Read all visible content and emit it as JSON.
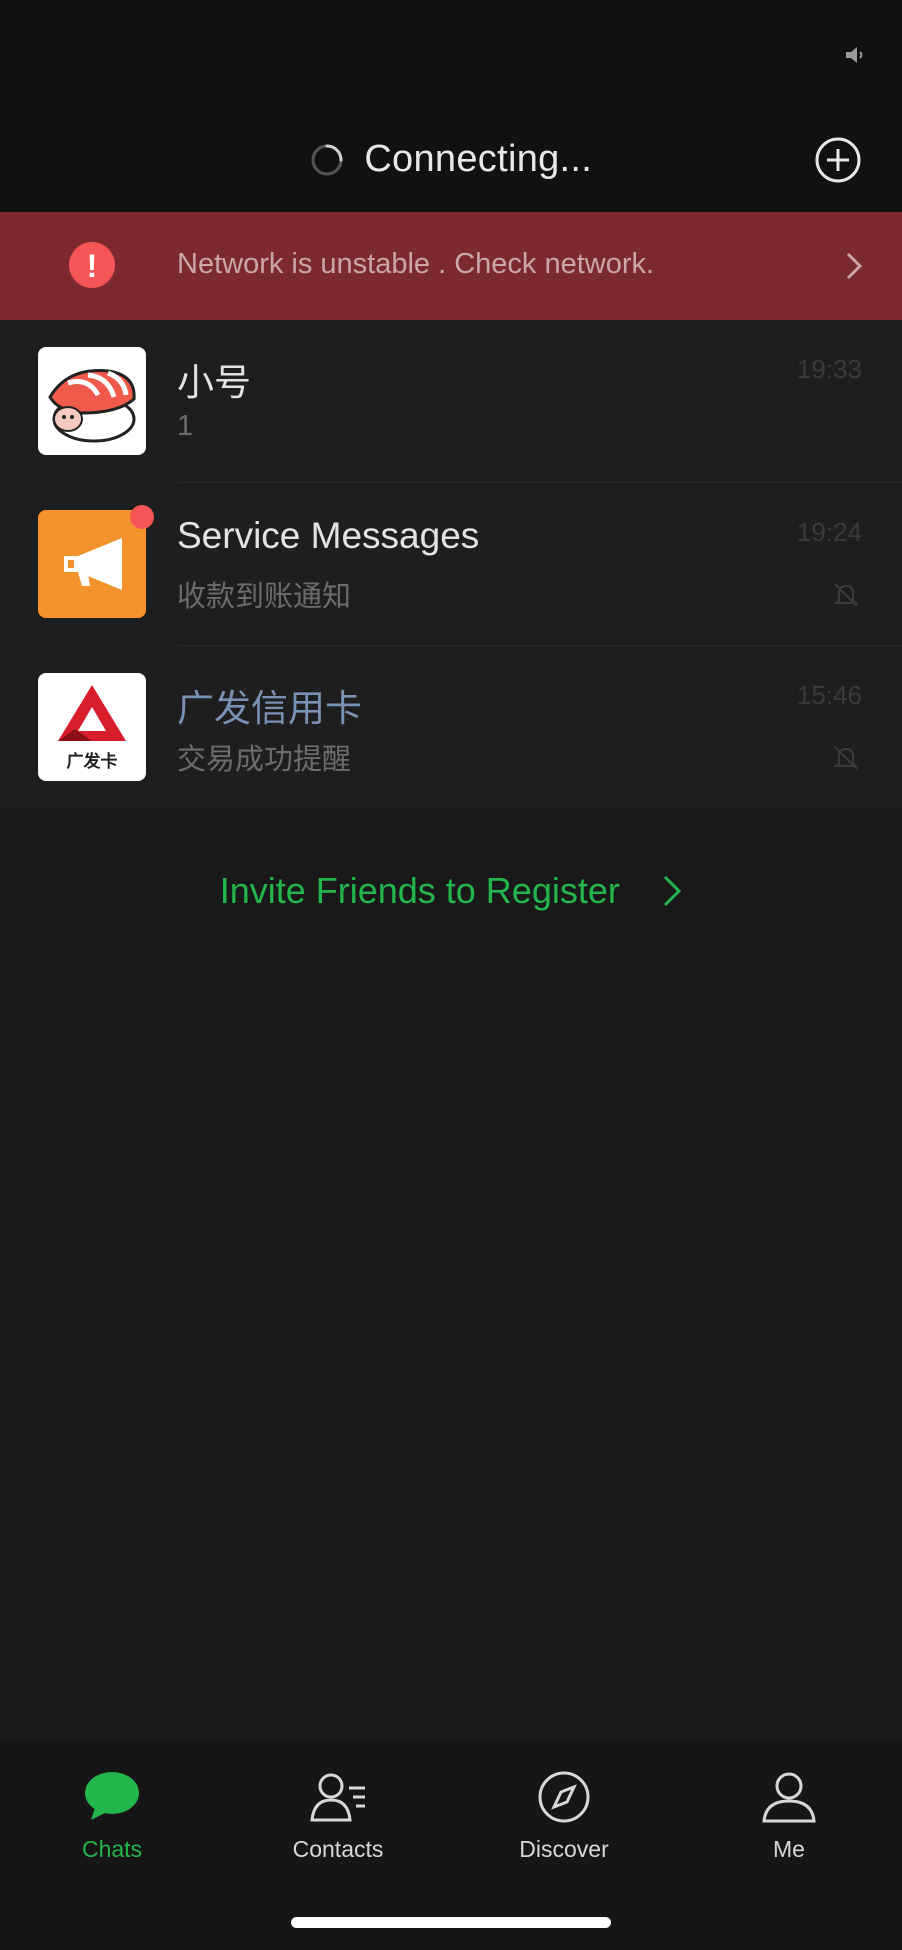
{
  "nav": {
    "title": "Connecting..."
  },
  "banner": {
    "text": "Network is unstable . Check network."
  },
  "chats": [
    {
      "name": "小号",
      "message": "1",
      "time": "19:33",
      "muted": false
    },
    {
      "name": "Service Messages",
      "message": "收款到账通知",
      "time": "19:24",
      "muted": true,
      "unread_dot": true
    },
    {
      "name": "广发信用卡",
      "message": "交易成功提醒",
      "time": "15:46",
      "muted": true,
      "avatar_text": "广发卡"
    }
  ],
  "invite": {
    "label": "Invite Friends to Register"
  },
  "tabs": [
    {
      "label": "Chats",
      "icon": "chat-bubble-icon",
      "active": true
    },
    {
      "label": "Contacts",
      "icon": "contacts-icon",
      "active": false
    },
    {
      "label": "Discover",
      "icon": "compass-icon",
      "active": false
    },
    {
      "label": "Me",
      "icon": "person-icon",
      "active": false
    }
  ],
  "colors": {
    "accent": "#23b64d",
    "banner_bg": "#7c2a30",
    "alert_red": "#f55555",
    "background": "#191919"
  }
}
